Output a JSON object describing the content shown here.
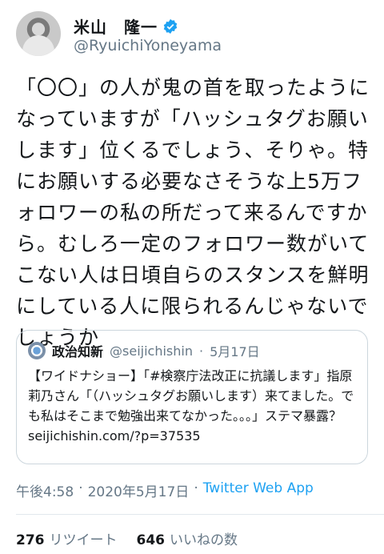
{
  "author": {
    "display_name": "米山　隆一",
    "handle": "@RyuichiYoneyama"
  },
  "tweet": {
    "text": "「〇〇」の人が鬼の首を取ったようになっていますが「ハッシュタグお願いします」位くるでしょう、そりゃ。特にお願いする必要なさそうな上5万フォロワーの私の所だって来るんですから。むしろ一定のフォロワー数がいてこない人は日頃自らのスタンスを鮮明にしている人に限られるんじゃないでしょうか"
  },
  "quote": {
    "name": "政治知新",
    "handle": "@seijichishin",
    "dot": "·",
    "date": "5月17日",
    "text": "【ワイドナショー】「#検察庁法改正に抗議します」指原莉乃さん「（ハッシュタグお願いします）来てました。でも私はそこまで勉強出来てなかった。。。」ステマ暴露？\nseijichishin.com/?p=37535"
  },
  "meta": {
    "time": "午後4:58",
    "dot": "·",
    "date": "2020年5月17日",
    "dot2": "·",
    "source": "Twitter Web App"
  },
  "stats": {
    "retweets": "276",
    "retweets_label": "リツイート",
    "likes": "646",
    "likes_label": "いいねの数"
  },
  "colors": {
    "link": "#1da1f2",
    "secondary": "#657786",
    "verified": "#1da1f2"
  },
  "icons": [
    "avatar",
    "verified-badge-icon",
    "chevron-down-icon"
  ]
}
